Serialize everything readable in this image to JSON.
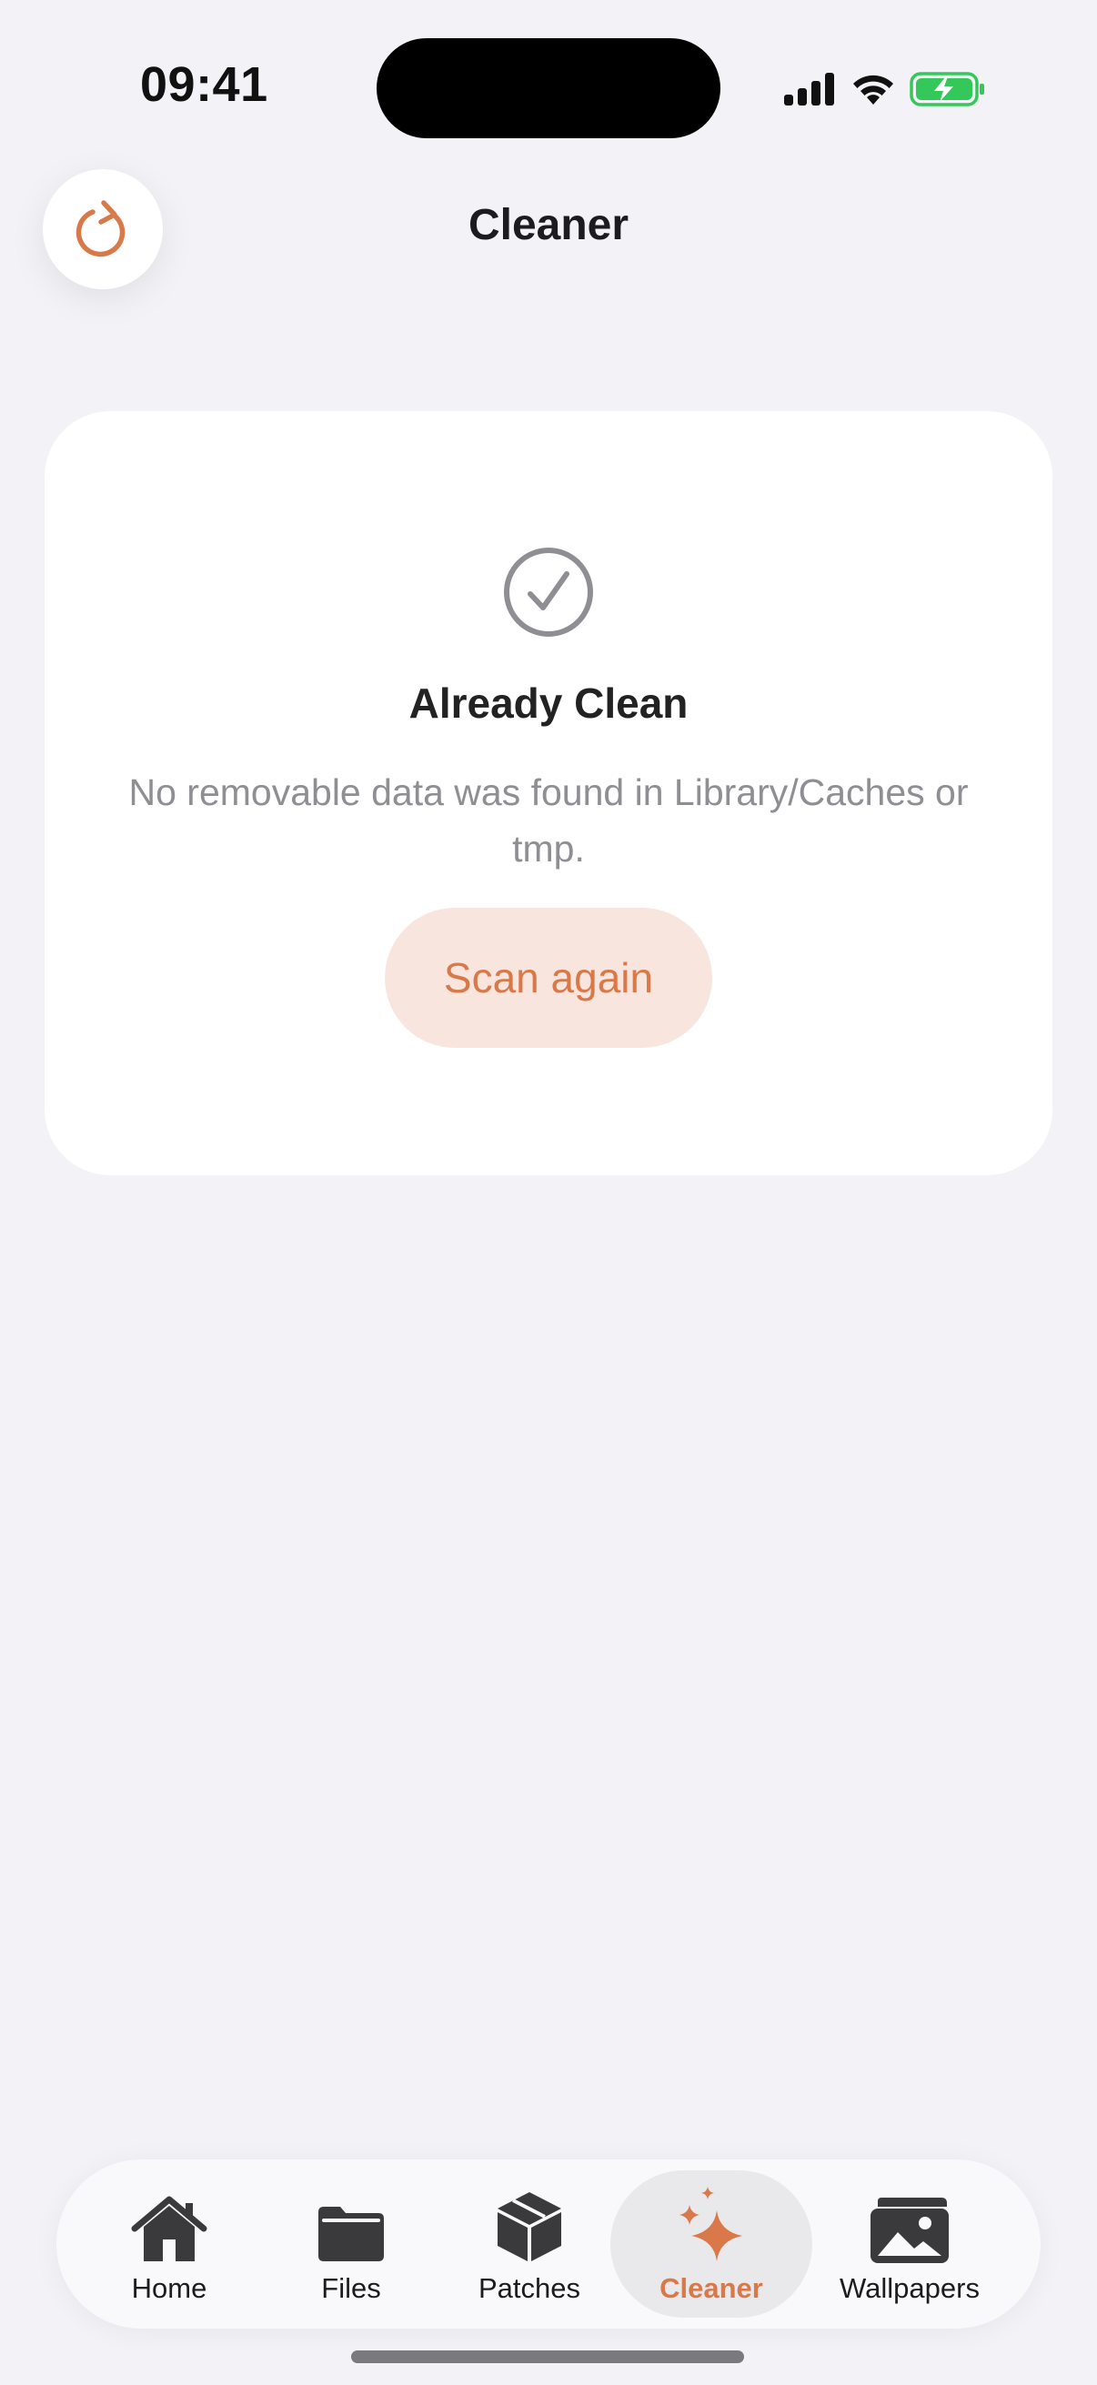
{
  "status_bar": {
    "time": "09:41",
    "battery_color": "#34c759"
  },
  "header": {
    "title": "Cleaner",
    "refresh_icon": "refresh-icon"
  },
  "card": {
    "icon": "checkmark-circle-icon",
    "title": "Already Clean",
    "message": "No removable data was found in Library/Caches or tmp.",
    "action_label": "Scan again"
  },
  "tabbar": {
    "active_tab": "Cleaner",
    "accent_color": "#d9794a",
    "tabs": [
      {
        "label": "Home",
        "icon": "house-icon"
      },
      {
        "label": "Files",
        "icon": "folder-icon"
      },
      {
        "label": "Patches",
        "icon": "box-icon"
      },
      {
        "label": "Cleaner",
        "icon": "sparkles-icon"
      },
      {
        "label": "Wallpapers",
        "icon": "photos-icon"
      }
    ]
  }
}
